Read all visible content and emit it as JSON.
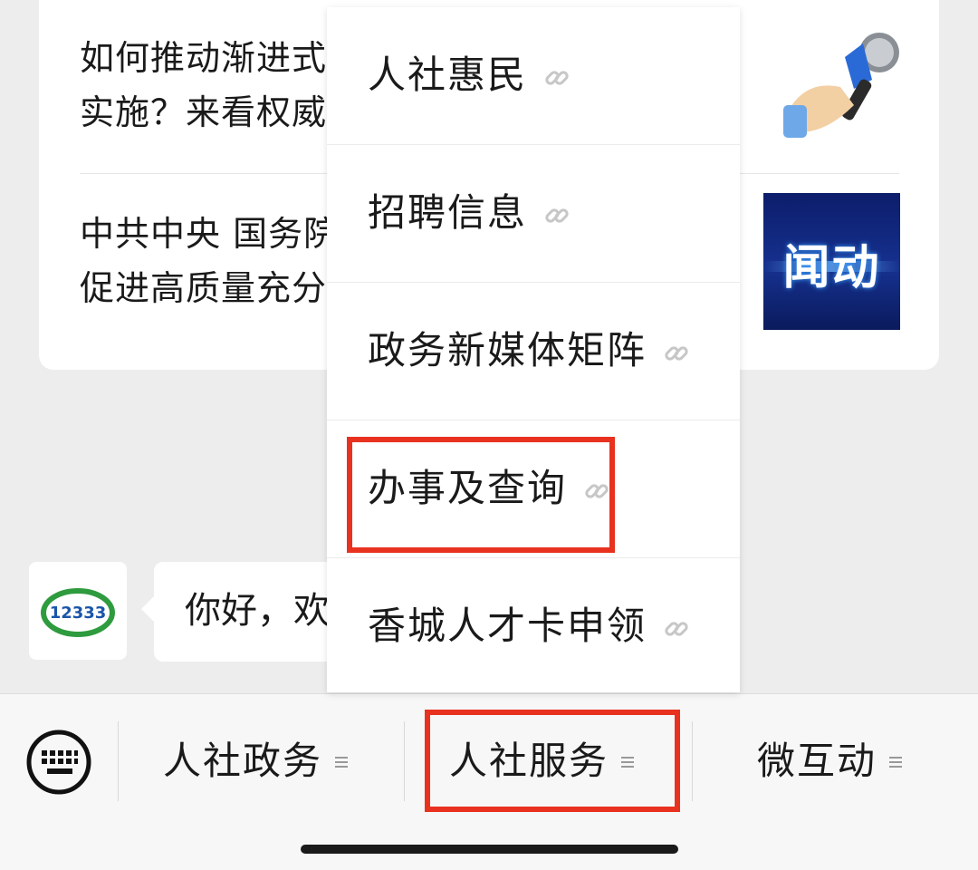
{
  "articles": [
    {
      "title": "如何推动渐进式\n实施？来看权威"
    },
    {
      "title": "中共中央 国务院\n促进高质量充分"
    }
  ],
  "news_thumb_label": "闻动",
  "chat": {
    "greeting": "你好，欢",
    "avatar_text": "12333"
  },
  "popup_menu": {
    "items": [
      {
        "label": "人社惠民"
      },
      {
        "label": "招聘信息"
      },
      {
        "label": "政务新媒体矩阵"
      },
      {
        "label": "办事及查询"
      },
      {
        "label": "香城人才卡申领"
      }
    ]
  },
  "bottom_menu": {
    "tabs": [
      {
        "label": "人社政务"
      },
      {
        "label": "人社服务"
      },
      {
        "label": "微互动"
      }
    ]
  },
  "colors": {
    "highlight": "#e8321f",
    "background": "#ededed"
  }
}
